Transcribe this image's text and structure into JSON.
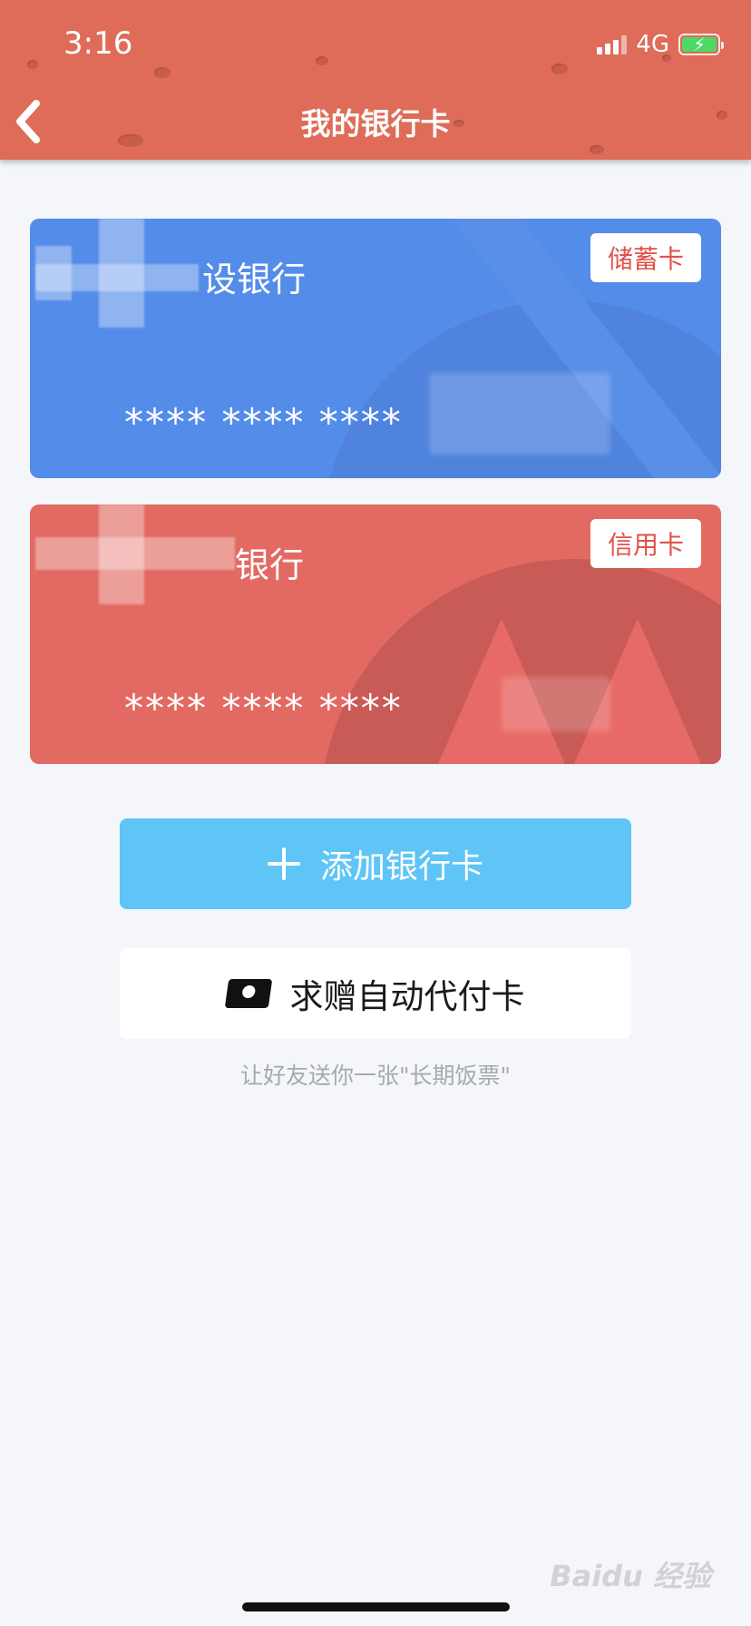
{
  "status_bar": {
    "time": "3:16",
    "network": "4G"
  },
  "nav": {
    "title": "我的银行卡",
    "back_icon": "chevron-left-icon"
  },
  "cards": [
    {
      "bank_name": "设银行",
      "type_tag": "储蓄卡",
      "number_masked": "**** **** ****",
      "color": "#548ce9"
    },
    {
      "bank_name": "银行",
      "type_tag": "信用卡",
      "number_masked": "**** **** ****",
      "color": "#e26a63"
    }
  ],
  "actions": {
    "add_card_label": "添加银行卡",
    "gift_card_label": "求赠自动代付卡",
    "gift_hint": "让好友送你一张\"长期饭票\""
  },
  "watermark": "Baidu 经验",
  "colors": {
    "header": "#de6c58",
    "accent": "#5ec5f6",
    "tag_text": "#e0524a",
    "background": "#f4f6fa"
  }
}
